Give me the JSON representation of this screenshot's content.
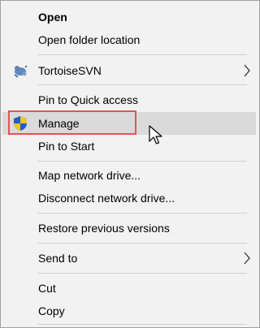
{
  "menu": {
    "items": [
      {
        "label": "Open"
      },
      {
        "label": "Open folder location"
      },
      {
        "label": "TortoiseSVN",
        "icon": "tortoisesvn-icon"
      },
      {
        "label": "Pin to Quick access"
      },
      {
        "label": "Manage",
        "icon": "uac-shield-icon"
      },
      {
        "label": "Pin to Start"
      },
      {
        "label": "Map network drive..."
      },
      {
        "label": "Disconnect network drive..."
      },
      {
        "label": "Restore previous versions"
      },
      {
        "label": "Send to"
      },
      {
        "label": "Cut"
      },
      {
        "label": "Copy"
      }
    ]
  },
  "colors": {
    "menu_background": "#f2f2f2",
    "hover_background": "#dadada",
    "highlight_border": "#e05555",
    "separator": "#d0d0d0"
  }
}
